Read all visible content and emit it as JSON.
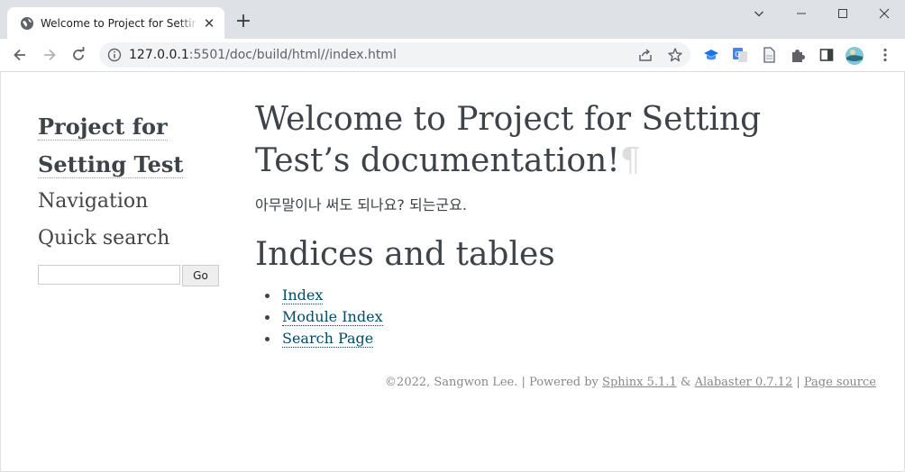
{
  "browser": {
    "tab": {
      "title": "Welcome to Project for Setting Test’s documentation!",
      "favicon": "globe-icon",
      "close_glyph": "✕"
    },
    "new_tab_glyph": "+",
    "url_host": "127.0.0.1",
    "url_rest": ":5501/doc/build/html//index.html"
  },
  "sidebar": {
    "logo_line1": "Project for",
    "logo_line2": "Setting Test",
    "navigation_heading": "Navigation",
    "quick_search_heading": "Quick search",
    "search_value": "",
    "go_label": "Go"
  },
  "main": {
    "title_line1": "Welcome to Project for Setting",
    "title_line2": "Test’s documentation!",
    "pilcrow": "¶",
    "intro_text": "아무말이나 써도 되나요? 되는군요.",
    "indices_heading": "Indices and tables",
    "links": [
      "Index",
      "Module Index",
      "Search Page"
    ]
  },
  "footer": {
    "copyright": "©2022, Sangwon Lee.",
    "sep1": " | Powered by ",
    "sphinx": "Sphinx 5.1.1",
    "amp": " & ",
    "alabaster": "Alabaster 0.7.12",
    "sep2": " | ",
    "page_source": "Page source"
  },
  "colors": {
    "text": "#3e4349",
    "link": "#004b6b",
    "chrome": "#dee1e6",
    "footer": "#888888"
  }
}
